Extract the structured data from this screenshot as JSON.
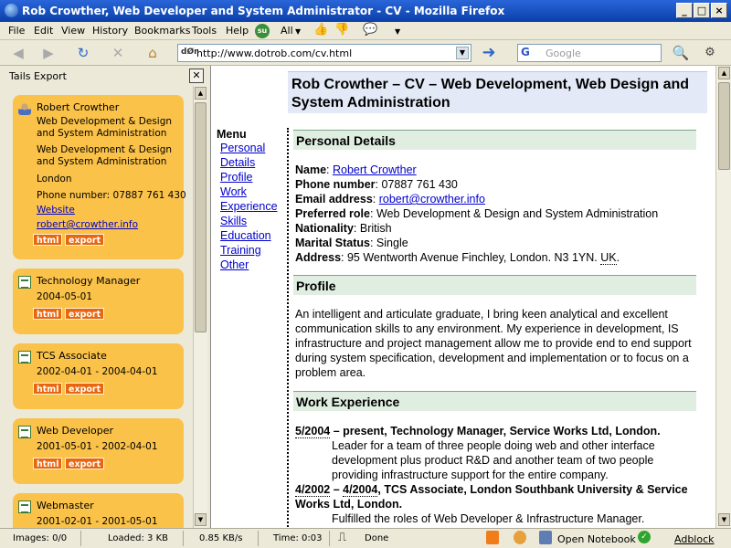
{
  "window": {
    "title": "Rob Crowther, Web Developer and System Administrator - CV - Mozilla Firefox"
  },
  "menubar": [
    "File",
    "Edit",
    "View",
    "History",
    "Bookmarks",
    "Tools",
    "Help",
    "All"
  ],
  "nav": {
    "url": "http://www.dotrob.com/cv.html",
    "search_placeholder": "Google",
    "favicon_text": "dØr"
  },
  "sidebar": {
    "title": "Tails Export",
    "person": {
      "name": "Robert Crowther",
      "role1": "Web Development & Design",
      "role1b": "and System Administration",
      "role2": "Web Development & Design",
      "role2b": "and System Administration",
      "city": "London",
      "phone": "Phone number: 07887 761 430",
      "website": "Website",
      "email": "robert@crowther.info",
      "html": "html",
      "export": "export"
    },
    "jobs": [
      {
        "title": "Technology Manager",
        "dates": "2004-05-01",
        "html": "html",
        "export": "export"
      },
      {
        "title": "TCS Associate",
        "dates": "2002-04-01 - 2004-04-01",
        "html": "html",
        "export": "export"
      },
      {
        "title": "Web Developer",
        "dates": "2001-05-01 - 2002-04-01",
        "html": "html",
        "export": "export"
      },
      {
        "title": "Webmaster",
        "dates": "2001-02-01 - 2001-05-01"
      }
    ]
  },
  "cv": {
    "heading": "Rob Crowther – CV – Web Development, Web Design and System Administration",
    "menu_title": "Menu",
    "menu": [
      "Personal",
      "Details",
      "Profile",
      "Work",
      "Experience",
      "Skills",
      "Education",
      "Training",
      "Other"
    ],
    "personal": {
      "heading": "Personal Details",
      "name_label": "Name",
      "name": "Robert Crowther",
      "phone_label": "Phone number",
      "phone": "07887 761 430",
      "email_label": "Email address",
      "email": "robert@crowther.info",
      "role_label": "Preferred role",
      "role": "Web Development & Design and System Administration",
      "nationality_label": "Nationality",
      "nationality": "British",
      "marital_label": "Marital Status",
      "marital": "Single",
      "address_label": "Address",
      "address": "95 Wentworth Avenue Finchley, London. N3 1YN.",
      "country": "UK"
    },
    "profile": {
      "heading": "Profile",
      "text": "An intelligent and articulate graduate, I bring keen analytical and excellent communication skills to any environment. My experience in development, IS infrastructure and project management allow me to provide end to end support during system specification, development and implementation or to focus on a problem area."
    },
    "work": {
      "heading": "Work Experience",
      "job1_start": "5/2004",
      "job1_rest": " – present, Technology Manager, Service Works Ltd, London.",
      "job1_desc": "Leader for a team of three people doing web and other interface development plus product R&D and another team of two people providing infrastructure support for the entire company.",
      "job2_start": "4/2002",
      "job2_mid": " – ",
      "job2_end": "4/2004",
      "job2_rest": ", TCS Associate, London Southbank University & Service Works Ltd, London.",
      "job2_desc": "Fulfilled the roles of Web Developer & Infrastructure Manager."
    }
  },
  "status": {
    "images": "Images: 0/0",
    "loaded": "Loaded: 3 KB",
    "speed": "0.85 KB/s",
    "time": "Time: 0:03",
    "done": "Done",
    "notebook": "Open Notebook",
    "adblock": "Adblock"
  }
}
